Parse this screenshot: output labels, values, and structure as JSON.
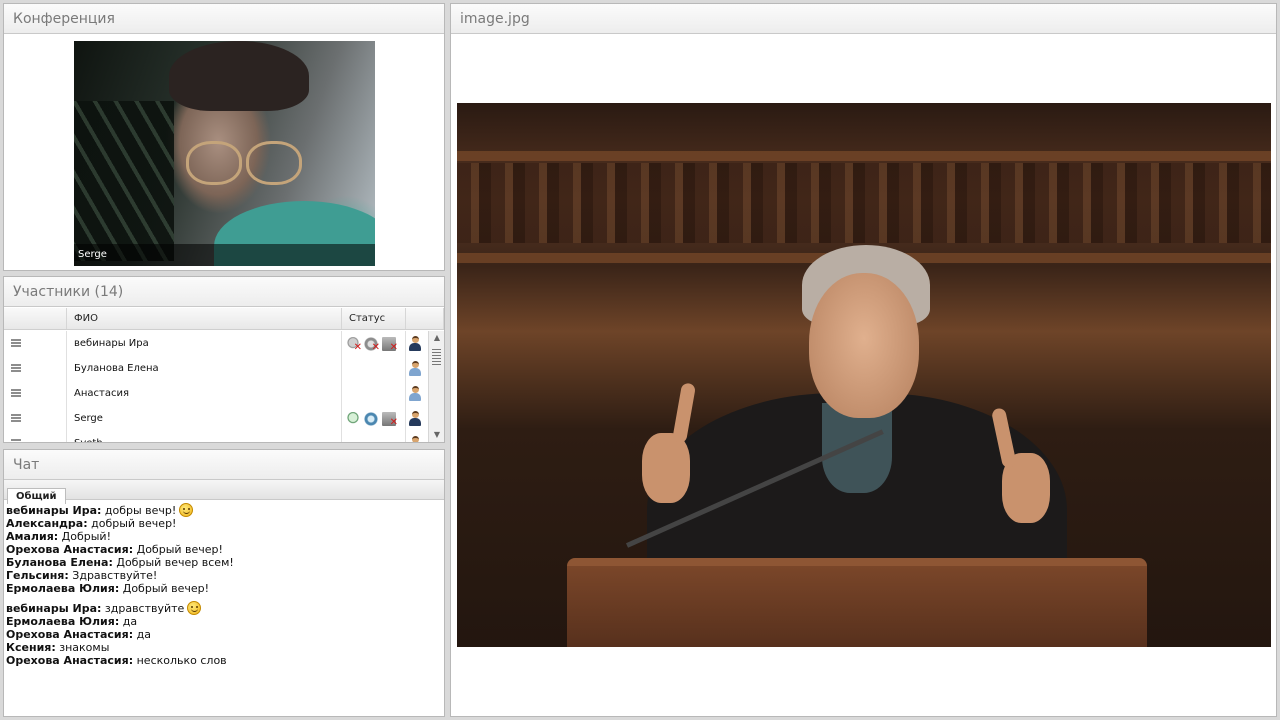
{
  "conference": {
    "title": "Конференция",
    "video_label": "Serge"
  },
  "participants": {
    "title": "Участники (14)",
    "columns": {
      "name": "ФИО",
      "status": "Статус"
    },
    "rows": [
      {
        "name": "вебинары Ира"
      },
      {
        "name": "Буланова Елена"
      },
      {
        "name": "Анастасия"
      },
      {
        "name": "Serge"
      },
      {
        "name": "Sveth"
      }
    ]
  },
  "chat": {
    "title": "Чат",
    "tab_label": "Общий",
    "messages": [
      {
        "user": "вебинары Ира:",
        "text": "добры вечр!",
        "smile": true
      },
      {
        "user": "Александра:",
        "text": "добрый вечер!"
      },
      {
        "user": "Амалия:",
        "text": "Добрый!"
      },
      {
        "user": "Орехова Анастасия:",
        "text": "Добрый вечер!"
      },
      {
        "user": "Буланова Елена:",
        "text": "Добрый вечер всем!"
      },
      {
        "user": "Гельсиня:",
        "text": "Здравствуйте!"
      },
      {
        "user": "Ермолаева Юлия:",
        "text": "Добрый вечер!"
      },
      {
        "user": "вебинары Ира:",
        "text": "здравствуйте",
        "smile": true
      },
      {
        "user": "Ермолаева Юлия:",
        "text": "да"
      },
      {
        "user": "Орехова Анастасия:",
        "text": "да"
      },
      {
        "user": "Ксения:",
        "text": "знакомы"
      },
      {
        "user": "Орехова Анастасия:",
        "text": "несколько слов"
      }
    ]
  },
  "viewer": {
    "title": "image.jpg"
  }
}
